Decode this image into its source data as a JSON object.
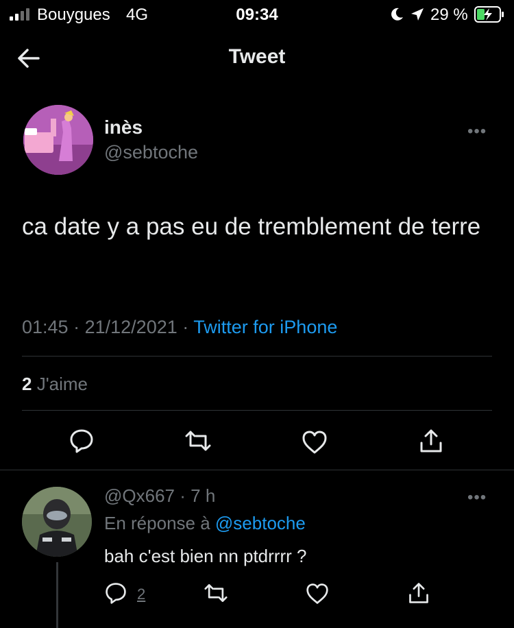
{
  "status_bar": {
    "carrier": "Bouygues",
    "network": "4G",
    "time": "09:34",
    "battery_percent": "29 %",
    "icons": [
      "signal-icon",
      "moon-icon",
      "location-icon",
      "battery-charging-icon"
    ]
  },
  "header": {
    "title": "Tweet",
    "back_icon": "arrow-left-icon"
  },
  "tweet": {
    "name": "inès",
    "handle": "@sebtoche",
    "text": "ca date y a pas eu de tremblement de terre",
    "time": "01:45",
    "date": "21/12/2021",
    "source": "Twitter for iPhone",
    "likes_count": "2",
    "likes_label": "J'aime",
    "more": "•••",
    "actions": [
      "reply-icon",
      "retweet-icon",
      "like-icon",
      "share-icon"
    ]
  },
  "reply": {
    "handle": "@Qx667",
    "age": "7 h",
    "in_reply_to_label": "En réponse à",
    "in_reply_to_handle": "@sebtoche",
    "text": "bah c'est bien nn ptdrrrr ?",
    "reply_count": "2",
    "more": "•••"
  },
  "colors": {
    "background": "#000000",
    "text": "#e7e9ea",
    "secondary": "#71767b",
    "accent": "#1d9bf0",
    "divider": "#2f3336"
  }
}
